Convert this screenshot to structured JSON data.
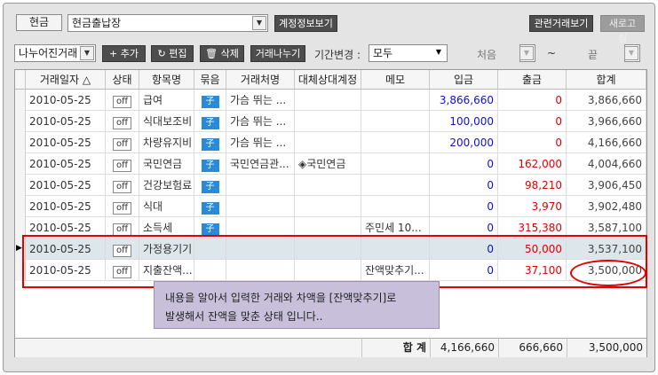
{
  "topbar": {
    "tab_label": "현금",
    "account_select": "현금출납장",
    "account_info_button": "계정정보보기",
    "related_button": "관련거래보기",
    "refresh_button": "새로고침"
  },
  "toolbar": {
    "view_select": "나누어진거래",
    "add_button": "+ 추가",
    "edit_button": "편집",
    "delete_button": "삭제",
    "split_button": "거래나누기",
    "period_label": "기간변경 :",
    "period_select": "모두",
    "start_label": "처음",
    "tilde": "~",
    "end_label": "끝"
  },
  "grid": {
    "columns": [
      "거래일자 △",
      "상태",
      "항목명",
      "묶음",
      "거래처명",
      "대체상대계정",
      "메모",
      "입금",
      "출금",
      "합계"
    ],
    "rows": [
      {
        "date": "2010-05-25",
        "status": "off",
        "item": "급여",
        "group": "子",
        "partner": "가슴 뛰는 ...",
        "contra": "",
        "memo": "",
        "deposit": "3,866,660",
        "withdraw": "0",
        "total": "3,866,660"
      },
      {
        "date": "2010-05-25",
        "status": "off",
        "item": "식대보조비",
        "group": "子",
        "partner": "가슴 뛰는 ...",
        "contra": "",
        "memo": "",
        "deposit": "100,000",
        "withdraw": "0",
        "total": "3,966,660"
      },
      {
        "date": "2010-05-25",
        "status": "off",
        "item": "차량유지비",
        "group": "子",
        "partner": "가슴 뛰는 ...",
        "contra": "",
        "memo": "",
        "deposit": "200,000",
        "withdraw": "0",
        "total": "4,166,660"
      },
      {
        "date": "2010-05-25",
        "status": "off",
        "item": "국민연금",
        "group": "子",
        "partner": "국민연금관...",
        "contra": "◈국민연금",
        "memo": "",
        "deposit": "0",
        "withdraw": "162,000",
        "total": "4,004,660"
      },
      {
        "date": "2010-05-25",
        "status": "off",
        "item": "건강보험료",
        "group": "子",
        "partner": "",
        "contra": "",
        "memo": "",
        "deposit": "0",
        "withdraw": "98,210",
        "total": "3,906,450"
      },
      {
        "date": "2010-05-25",
        "status": "off",
        "item": "식대",
        "group": "子",
        "partner": "",
        "contra": "",
        "memo": "",
        "deposit": "0",
        "withdraw": "3,970",
        "total": "3,902,480"
      },
      {
        "date": "2010-05-25",
        "status": "off",
        "item": "소득세",
        "group": "子",
        "partner": "",
        "contra": "",
        "memo": "주민세 10...",
        "deposit": "0",
        "withdraw": "315,380",
        "total": "3,587,100"
      },
      {
        "date": "2010-05-25",
        "status": "off",
        "item": "가정용기기",
        "group": "",
        "partner": "",
        "contra": "",
        "memo": "",
        "deposit": "0",
        "withdraw": "50,000",
        "total": "3,537,100"
      },
      {
        "date": "2010-05-25",
        "status": "off",
        "item": "지출잔액...",
        "group": "",
        "partner": "",
        "contra": "",
        "memo": "잔액맞추기...",
        "deposit": "0",
        "withdraw": "37,100",
        "total": "3,500,000"
      }
    ],
    "footer": {
      "label": "합 계",
      "deposit": "4,166,660",
      "withdraw": "666,660",
      "total": "3,500,000"
    }
  },
  "tooltip": {
    "line1": "내용을 알아서 입력한 거래와 차액을 [잔액맞추기]로",
    "line2": "발생해서 잔액을 맞춘 상태 입니다.."
  },
  "colors": {
    "deposit": "#1111cc",
    "withdraw": "#e00000",
    "annotation": "#e00000",
    "group_badge": "#2a8ad8"
  }
}
